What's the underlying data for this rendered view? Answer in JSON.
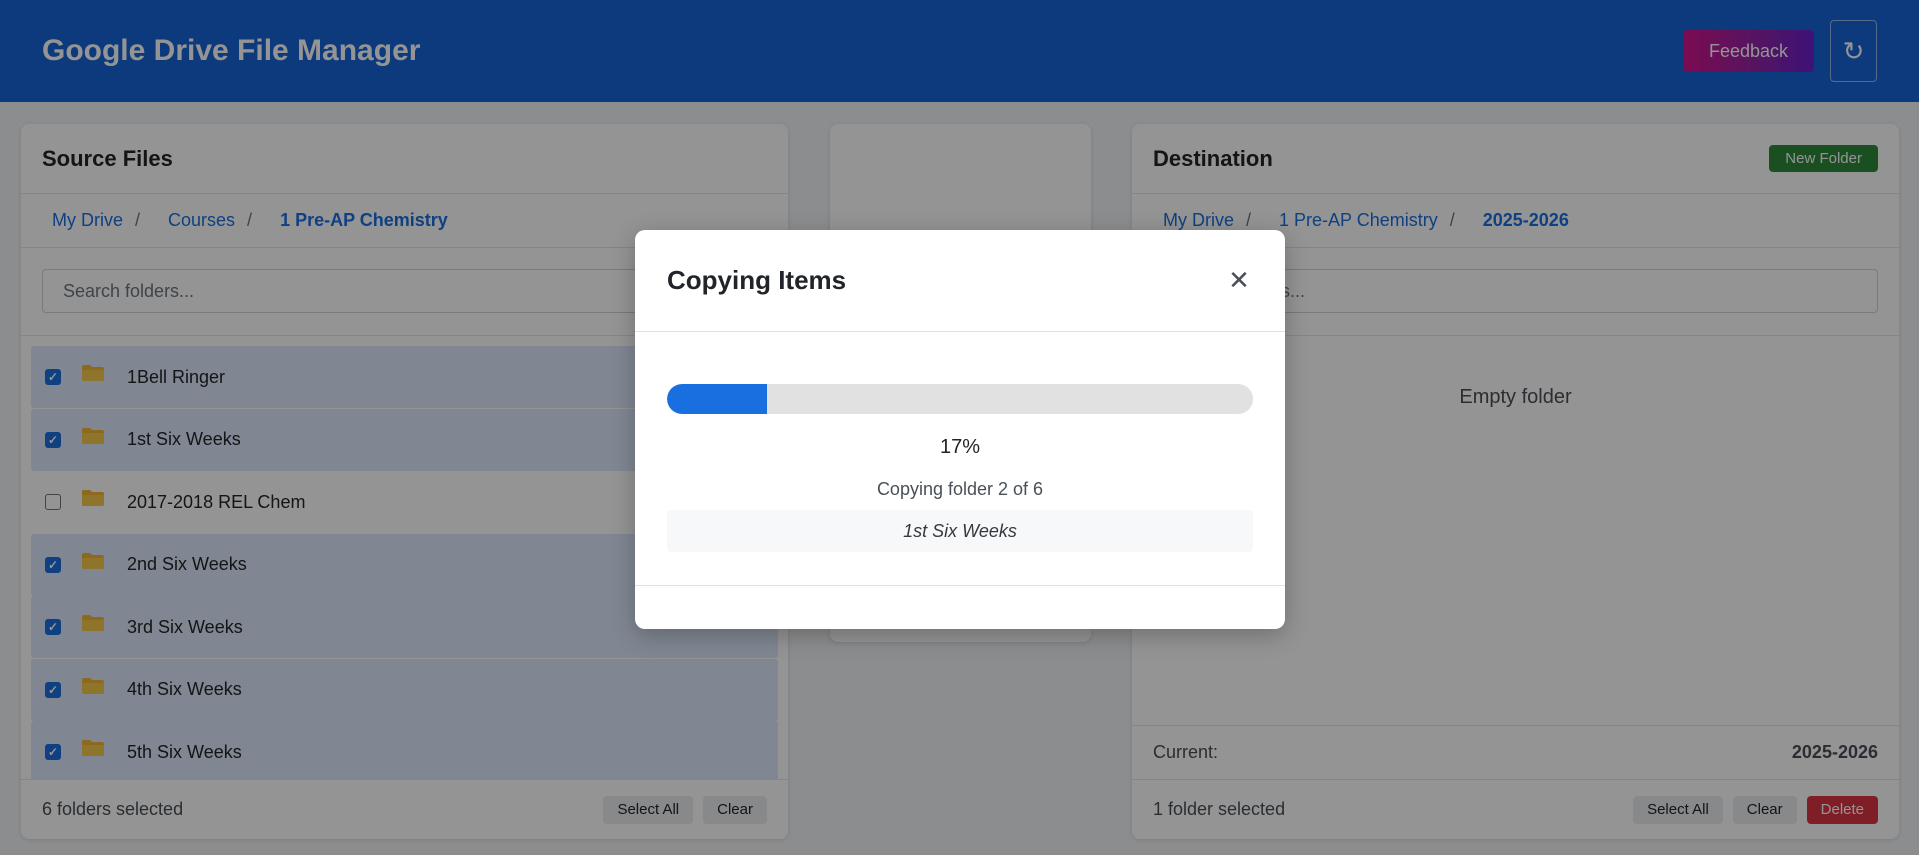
{
  "header": {
    "title": "Google Drive File Manager",
    "feedback_label": "Feedback",
    "refresh_glyph": "↻"
  },
  "source": {
    "title": "Source Files",
    "breadcrumb": [
      "My Drive",
      "Courses",
      "1 Pre-AP Chemistry"
    ],
    "separator": "/",
    "search_placeholder": "Search folders...",
    "folders": [
      {
        "name": "1Bell Ringer",
        "checked": true
      },
      {
        "name": "1st Six Weeks",
        "checked": true
      },
      {
        "name": "2017-2018 REL Chem",
        "checked": false
      },
      {
        "name": "2nd Six Weeks",
        "checked": true
      },
      {
        "name": "3rd Six Weeks",
        "checked": true
      },
      {
        "name": "4th Six Weeks",
        "checked": true
      },
      {
        "name": "5th Six Weeks",
        "checked": true
      }
    ],
    "status": "6 folders selected",
    "select_all_label": "Select All",
    "clear_label": "Clear"
  },
  "destination": {
    "title": "Destination",
    "new_folder_label": "New Folder",
    "breadcrumb": [
      "My Drive",
      "1 Pre-AP Chemistry",
      "2025-2026"
    ],
    "separator": "/",
    "search_placeholder": "Search folders...",
    "empty_text": "Empty folder",
    "current_label": "Current:",
    "current_value": "2025-2026",
    "status": "1 folder selected",
    "select_all_label": "Select All",
    "clear_label": "Clear",
    "delete_label": "Delete"
  },
  "modal": {
    "title": "Copying Items",
    "close_glyph": "✕",
    "progress": 0.17,
    "percent_label": "17%",
    "status": "Copying folder 2 of 6",
    "current_item": "1st Six Weeks"
  },
  "colors": {
    "header": "#1565d8",
    "accent": "#1a6fe0",
    "selected_row": "#dce9fb",
    "success": "#2e8b3a",
    "danger": "#dc3545"
  }
}
